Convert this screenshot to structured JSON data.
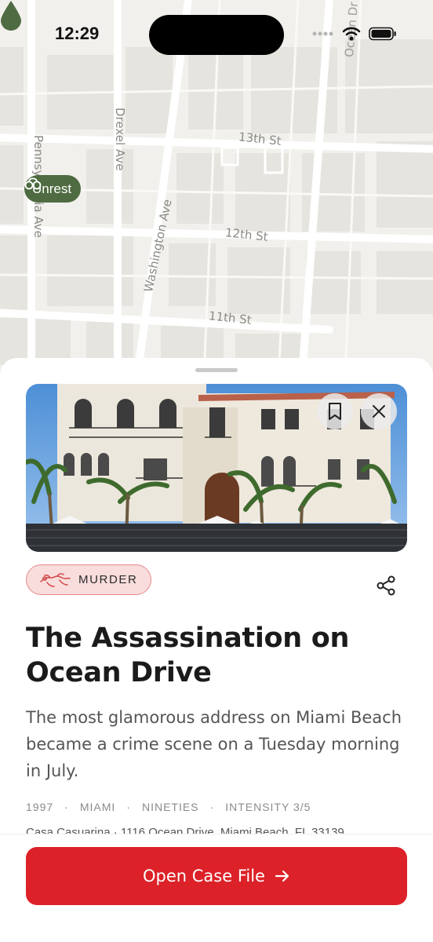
{
  "status_bar": {
    "time": "12:29"
  },
  "map": {
    "streets": {
      "drexel": "Drexel Ave",
      "pennsylvania": "Pennsylvania Ave",
      "washington": "Washington Ave",
      "st13": "13th St",
      "st12": "12th St",
      "st11": "11th St",
      "ocean": "Ocean Dr"
    },
    "pin": {
      "label": "Unrest",
      "icon": "handcuffs-icon",
      "color": "#4e6b41"
    }
  },
  "sheet": {
    "category": {
      "label": "MURDER",
      "icon": "chalk-outline-icon"
    },
    "title": "The Assassination on Ocean Drive",
    "description": "The most glamorous address on Miami Beach became a crime scene on a Tuesday morning in July.",
    "meta": [
      "1997",
      "MIAMI",
      "NINETIES",
      "INTENSITY 3/5"
    ],
    "address": "Casa Casuarina · 1116 Ocean Drive, Miami Beach, FL 33139",
    "cta_label": "Open Case File"
  },
  "colors": {
    "accent": "#dc2128",
    "badge_bg": "#f9dcdc",
    "pin": "#4e6b41"
  }
}
